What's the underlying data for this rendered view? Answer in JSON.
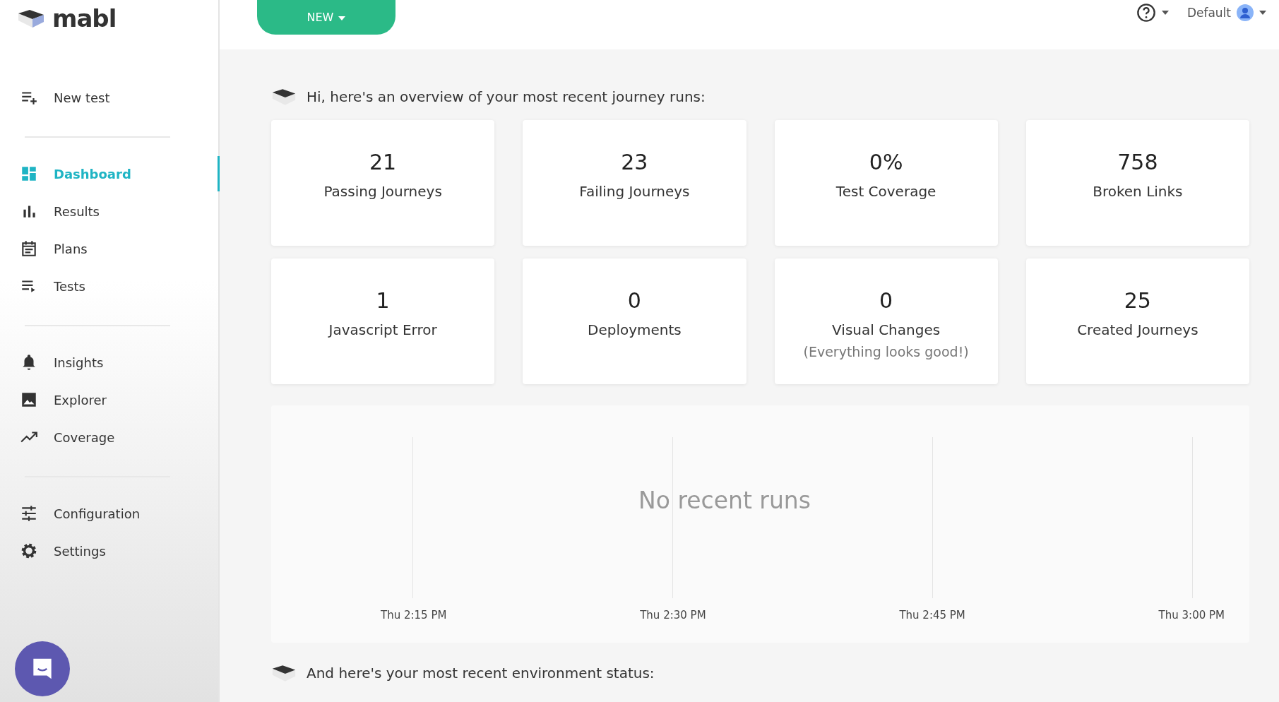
{
  "logo": {
    "text": "mabl"
  },
  "new_button": {
    "label": "NEW"
  },
  "header": {
    "workspace": "Default"
  },
  "sidebar": {
    "groups": [
      [
        {
          "label": "New test",
          "selected": false
        }
      ],
      [
        {
          "label": "Dashboard",
          "selected": true
        },
        {
          "label": "Results",
          "selected": false
        },
        {
          "label": "Plans",
          "selected": false
        },
        {
          "label": "Tests",
          "selected": false
        }
      ],
      [
        {
          "label": "Insights",
          "selected": false
        },
        {
          "label": "Explorer",
          "selected": false
        },
        {
          "label": "Coverage",
          "selected": false
        }
      ],
      [
        {
          "label": "Configuration",
          "selected": false
        },
        {
          "label": "Settings",
          "selected": false
        }
      ]
    ]
  },
  "greeting": "Hi, here's an overview of your most recent journey runs:",
  "stats": [
    {
      "value": "21",
      "label": "Passing Journeys"
    },
    {
      "value": "23",
      "label": "Failing Journeys"
    },
    {
      "value": "0%",
      "label": "Test Coverage"
    },
    {
      "value": "758",
      "label": "Broken Links"
    },
    {
      "value": "1",
      "label": "Javascript Error"
    },
    {
      "value": "0",
      "label": "Deployments"
    },
    {
      "value": "0",
      "label": "Visual Changes",
      "note": "(Everything looks good!)"
    },
    {
      "value": "25",
      "label": "Created Journeys"
    }
  ],
  "runs_chart": {
    "empty_message": "No recent runs",
    "time_labels": [
      "Thu 2:15 PM",
      "Thu 2:30 PM",
      "Thu 2:45 PM",
      "Thu 3:00 PM"
    ]
  },
  "env_status": "And here's your most recent environment status:"
}
